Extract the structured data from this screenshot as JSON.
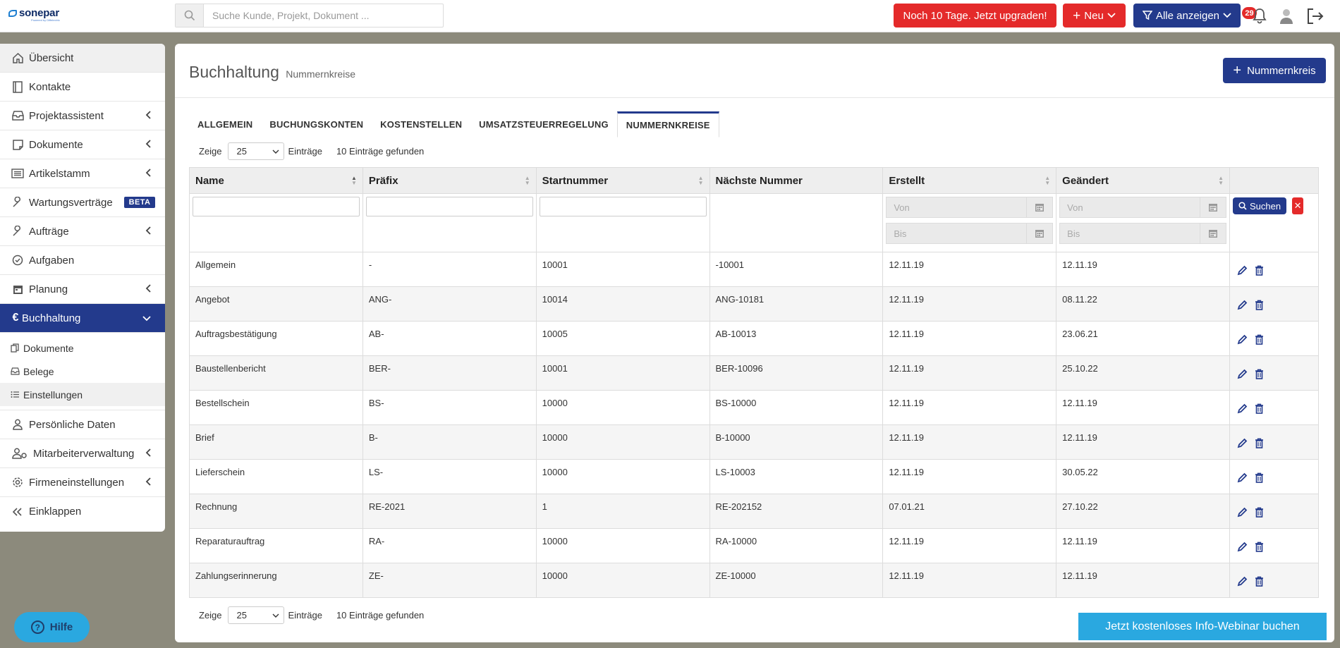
{
  "brand": {
    "name": "sonepar",
    "sub": "Powered by Diffelectric"
  },
  "search": {
    "placeholder": "Suche Kunde, Projekt, Dokument ..."
  },
  "topbar": {
    "upgrade_label": "Noch 10 Tage. Jetzt upgraden!",
    "neu_label": "Neu",
    "alle_label": "Alle anzeigen",
    "notification_count": "29"
  },
  "sidebar": {
    "items": [
      {
        "label": "Übersicht",
        "icon": "home-icon"
      },
      {
        "label": "Kontakte",
        "icon": "contacts-icon"
      },
      {
        "label": "Projektassistent",
        "icon": "inbox-icon"
      },
      {
        "label": "Dokumente",
        "icon": "document-icon"
      },
      {
        "label": "Artikelstamm",
        "icon": "list-icon"
      },
      {
        "label": "Wartungsverträge",
        "icon": "wrench-icon",
        "badge": "BETA"
      },
      {
        "label": "Aufträge",
        "icon": "wrench-icon"
      },
      {
        "label": "Aufgaben",
        "icon": "check-circle-icon"
      },
      {
        "label": "Planung",
        "icon": "calendar-icon"
      },
      {
        "label": "Buchhaltung",
        "icon": "euro-icon"
      }
    ],
    "sub_items": [
      {
        "label": "Dokumente"
      },
      {
        "label": "Belege"
      },
      {
        "label": "Einstellungen"
      }
    ],
    "items_after": [
      {
        "label": "Persönliche Daten"
      },
      {
        "label": "Mitarbeiterverwaltung"
      },
      {
        "label": "Firmeneinstellungen"
      },
      {
        "label": "Einklappen"
      }
    ]
  },
  "page": {
    "title": "Buchhaltung",
    "subtitle": "Nummernkreise",
    "add_button": "Nummernkreis"
  },
  "tabs": [
    "ALLGEMEIN",
    "BUCHUNGSKONTEN",
    "KOSTENSTELLEN",
    "UMSATZSTEUERREGELUNG",
    "NUMMERNKREISE"
  ],
  "paging": {
    "show_label": "Zeige",
    "page_size": "25",
    "entries_label": "Einträge",
    "found_label": "10 Einträge gefunden"
  },
  "table": {
    "columns": [
      "Name",
      "Präfix",
      "Startnummer",
      "Nächste Nummer",
      "Erstellt",
      "Geändert"
    ],
    "filter": {
      "from": "Von",
      "to": "Bis",
      "search_button": "Suchen",
      "clear": "✕"
    },
    "rows": [
      {
        "name": "Allgemein",
        "prefix": "-",
        "start": "10001",
        "next": "-10001",
        "created": "12.11.19",
        "changed": "12.11.19"
      },
      {
        "name": "Angebot",
        "prefix": "ANG-",
        "start": "10014",
        "next": "ANG-10181",
        "created": "12.11.19",
        "changed": "08.11.22"
      },
      {
        "name": "Auftragsbestätigung",
        "prefix": "AB-",
        "start": "10005",
        "next": "AB-10013",
        "created": "12.11.19",
        "changed": "23.06.21"
      },
      {
        "name": "Baustellenbericht",
        "prefix": "BER-",
        "start": "10001",
        "next": "BER-10096",
        "created": "12.11.19",
        "changed": "25.10.22"
      },
      {
        "name": "Bestellschein",
        "prefix": "BS-",
        "start": "10000",
        "next": "BS-10000",
        "created": "12.11.19",
        "changed": "12.11.19"
      },
      {
        "name": "Brief",
        "prefix": "B-",
        "start": "10000",
        "next": "B-10000",
        "created": "12.11.19",
        "changed": "12.11.19"
      },
      {
        "name": "Lieferschein",
        "prefix": "LS-",
        "start": "10000",
        "next": "LS-10003",
        "created": "12.11.19",
        "changed": "30.05.22"
      },
      {
        "name": "Rechnung",
        "prefix": "RE-2021",
        "start": "1",
        "next": "RE-202152",
        "created": "07.01.21",
        "changed": "27.10.22"
      },
      {
        "name": "Reparaturauftrag",
        "prefix": "RA-",
        "start": "10000",
        "next": "RA-10000",
        "created": "12.11.19",
        "changed": "12.11.19"
      },
      {
        "name": "Zahlungserinnerung",
        "prefix": "ZE-",
        "start": "10000",
        "next": "ZE-10000",
        "created": "12.11.19",
        "changed": "12.11.19"
      }
    ]
  },
  "help_label": "Hilfe",
  "webinar_label": "Jetzt kostenloses Info-Webinar buchen",
  "colors": {
    "primary": "#233a8c",
    "danger": "#e42a2a",
    "info": "#2aa8e0"
  }
}
